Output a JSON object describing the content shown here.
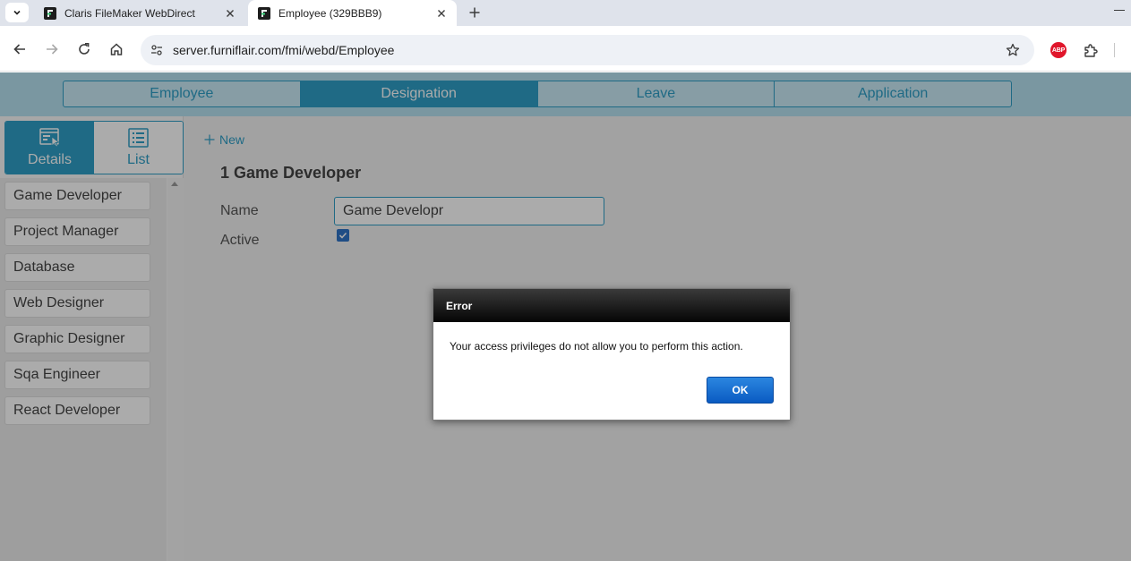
{
  "browser": {
    "tabs": [
      {
        "title": "Claris FileMaker WebDirect",
        "active": false
      },
      {
        "title": "Employee (329BBB9)",
        "active": true
      }
    ],
    "address": "server.furniflair.com/fmi/webd/Employee",
    "extension_abp_label": "ABP"
  },
  "app": {
    "nav_tabs": [
      {
        "label": "Employee",
        "active": false
      },
      {
        "label": "Designation",
        "active": true
      },
      {
        "label": "Leave",
        "active": false
      },
      {
        "label": "Application",
        "active": false
      }
    ],
    "view_switch": {
      "details_label": "Details",
      "list_label": "List",
      "active": "Details"
    },
    "list_items": [
      "Game Developer",
      "Project Manager",
      "Database",
      "Web Designer",
      "Graphic Designer",
      "Sqa Engineer",
      "React Developer"
    ],
    "new_label": "New",
    "record_title": "1 Game Developer",
    "fields": {
      "name_label": "Name",
      "name_value": "Game Developr",
      "active_label": "Active",
      "active_checked": true
    }
  },
  "dialog": {
    "title": "Error",
    "message": "Your access privileges do not allow you to perform this action.",
    "ok_label": "OK"
  },
  "colors": {
    "accent": "#2f9fc6",
    "dialog_button": "#0a5bc2"
  }
}
